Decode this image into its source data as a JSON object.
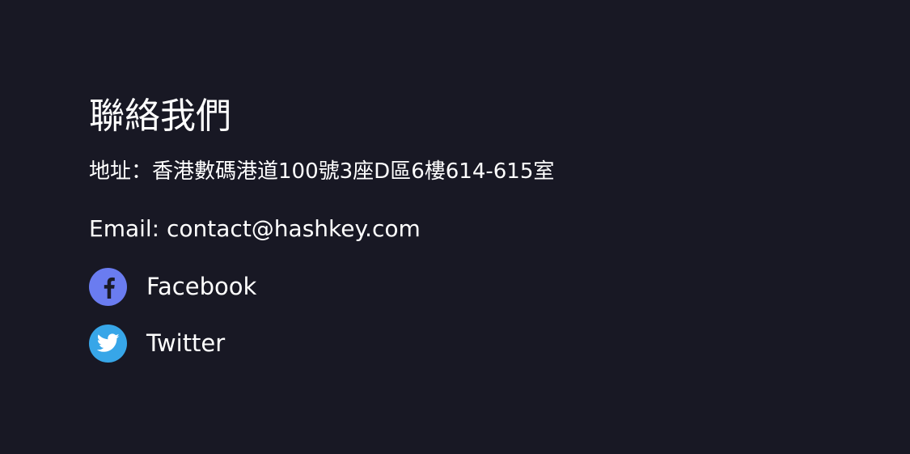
{
  "contact": {
    "title": "聯絡我們",
    "address": "地址：香港數碼港道100號3座D區6樓614-615室",
    "email": "Email: contact@hashkey.com",
    "social": [
      {
        "label": "Facebook",
        "icon": "facebook-icon",
        "color": "#6a7cf0"
      },
      {
        "label": "Twitter",
        "icon": "twitter-icon",
        "color": "#37a6e8"
      }
    ]
  },
  "theme": {
    "background": "#181824",
    "text": "#ffffff"
  }
}
